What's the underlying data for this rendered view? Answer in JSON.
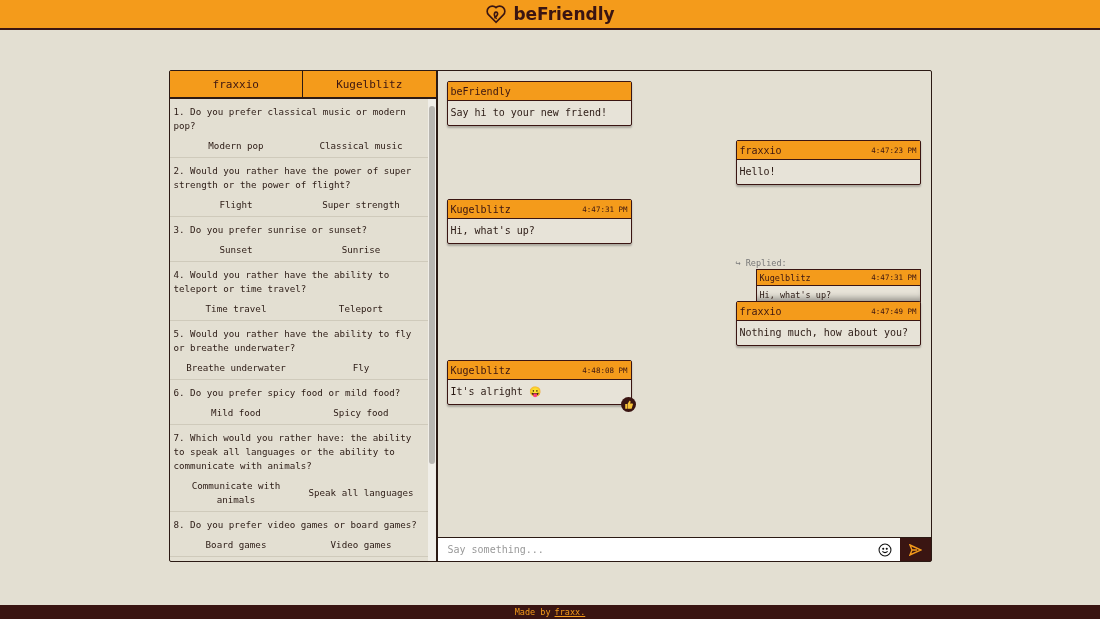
{
  "header": {
    "title": "beFriendly"
  },
  "participants": [
    {
      "name": "fraxxio"
    },
    {
      "name": "Kugelblitz"
    }
  ],
  "questions": [
    {
      "text": "1. Do you prefer classical music or modern pop?",
      "options": [
        "Modern pop",
        "Classical music"
      ]
    },
    {
      "text": "2. Would you rather have the power of super strength or the power of flight?",
      "options": [
        "Flight",
        "Super strength"
      ]
    },
    {
      "text": "3. Do you prefer sunrise or sunset?",
      "options": [
        "Sunset",
        "Sunrise"
      ]
    },
    {
      "text": "4. Would you rather have the ability to teleport or time travel?",
      "options": [
        "Time travel",
        "Teleport"
      ]
    },
    {
      "text": "5. Would you rather have the ability to fly or breathe underwater?",
      "options": [
        "Breathe underwater",
        "Fly"
      ]
    },
    {
      "text": "6. Do you prefer spicy food or mild food?",
      "options": [
        "Mild food",
        "Spicy food"
      ]
    },
    {
      "text": "7. Which would you rather have: the ability to speak all languages or the ability to communicate with animals?",
      "options": [
        "Communicate with animals",
        "Speak all languages"
      ]
    },
    {
      "text": "8. Do you prefer video games or board games?",
      "options": [
        "Board games",
        "Video games"
      ]
    }
  ],
  "messages": [
    {
      "kind": "received",
      "sender": "beFriendly",
      "text": "Say hi to your new friend!"
    },
    {
      "kind": "sent",
      "sender": "fraxxio",
      "time": "4:47:23 PM",
      "text": "Hello!"
    },
    {
      "kind": "received",
      "sender": "Kugelblitz",
      "time": "4:47:31 PM",
      "text": "Hi, what's up?"
    },
    {
      "kind": "sent",
      "sender": "fraxxio",
      "time": "4:47:49 PM",
      "text": "Nothing much, how about you?",
      "reply": {
        "label": "↪ Replied:",
        "sender": "Kugelblitz",
        "time": "4:47:31 PM",
        "text": "Hi, what's up?"
      }
    },
    {
      "kind": "received",
      "sender": "Kugelblitz",
      "time": "4:48:08 PM",
      "text": "It's alright 😛",
      "liked": true
    }
  ],
  "composer": {
    "placeholder": "Say something..."
  },
  "footer": {
    "text": "Made by",
    "link": "fraxx."
  }
}
